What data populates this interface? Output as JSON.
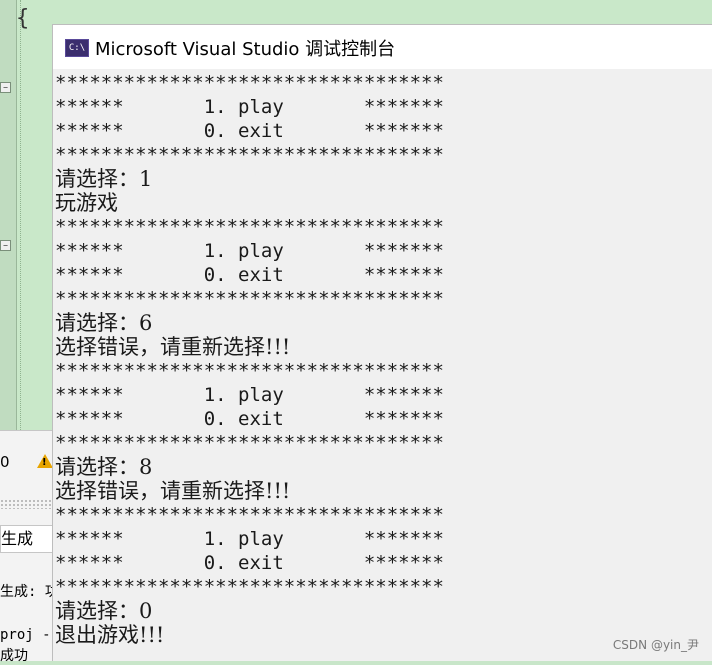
{
  "editor": {
    "brace": "{"
  },
  "ide_panel": {
    "zero": "0",
    "warning_icon": "warning-triangle-icon",
    "tab_label": "生成",
    "output_line_1": "生成: 功",
    "output_line_2": "proj -",
    "output_line_3": "成功"
  },
  "console": {
    "title": "Microsoft Visual Studio 调试控制台",
    "icon_text": "C:\\",
    "lines": [
      "**********************************",
      "******       1. play       *******",
      "******       0. exit       *******",
      "**********************************",
      "请选择：1",
      "玩游戏",
      "**********************************",
      "******       1. play       *******",
      "******       0. exit       *******",
      "**********************************",
      "请选择：6",
      "选择错误，请重新选择!!!",
      "**********************************",
      "******       1. play       *******",
      "******       0. exit       *******",
      "**********************************",
      "请选择：8",
      "选择错误，请重新选择!!!",
      "**********************************",
      "******       1. play       *******",
      "******       0. exit       *******",
      "**********************************",
      "请选择：0",
      "退出游戏!!!"
    ]
  },
  "watermark": "CSDN @yin_尹"
}
